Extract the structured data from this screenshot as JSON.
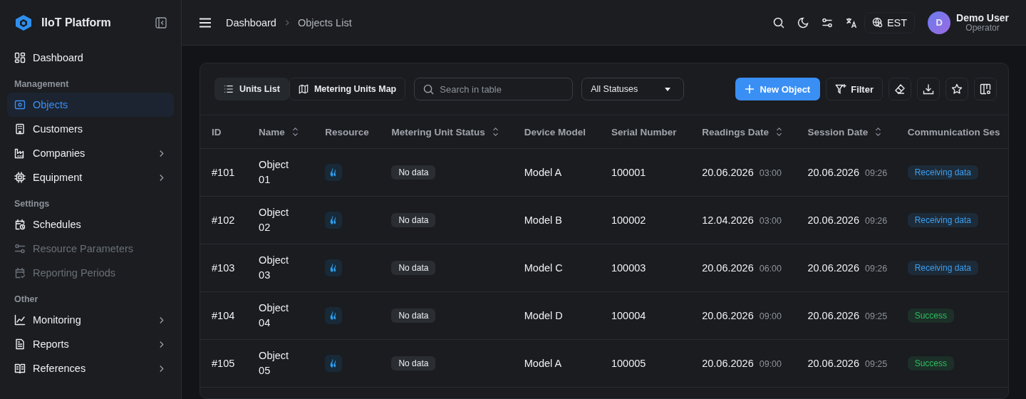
{
  "app": {
    "title": "IIoT Platform"
  },
  "sidebar": {
    "sections": [
      {
        "items": [
          {
            "label": "Dashboard",
            "selected": false,
            "disabled": false,
            "has_submenu": false
          }
        ]
      },
      {
        "heading": "Management",
        "items": [
          {
            "label": "Objects",
            "selected": true,
            "disabled": false,
            "has_submenu": false
          },
          {
            "label": "Customers",
            "selected": false,
            "disabled": false,
            "has_submenu": false
          },
          {
            "label": "Companies",
            "selected": false,
            "disabled": false,
            "has_submenu": true
          },
          {
            "label": "Equipment",
            "selected": false,
            "disabled": false,
            "has_submenu": true
          }
        ]
      },
      {
        "heading": "Settings",
        "items": [
          {
            "label": "Schedules",
            "selected": false,
            "disabled": false,
            "has_submenu": false
          },
          {
            "label": "Resource Parameters",
            "selected": false,
            "disabled": true,
            "has_submenu": false
          },
          {
            "label": "Reporting Periods",
            "selected": false,
            "disabled": true,
            "has_submenu": false
          }
        ]
      },
      {
        "heading": "Other",
        "items": [
          {
            "label": "Monitoring",
            "selected": false,
            "disabled": false,
            "has_submenu": true
          },
          {
            "label": "Reports",
            "selected": false,
            "disabled": false,
            "has_submenu": true
          },
          {
            "label": "References",
            "selected": false,
            "disabled": false,
            "has_submenu": true
          }
        ]
      }
    ]
  },
  "header": {
    "breadcrumbs": [
      "Dashboard",
      "Objects List"
    ],
    "timezone": "EST",
    "user": {
      "initial": "D",
      "name": "Demo User",
      "role": "Operator"
    }
  },
  "toolbar": {
    "views": [
      {
        "label": "Units List",
        "selected": true
      },
      {
        "label": "Metering Units Map",
        "selected": false
      }
    ],
    "search": {
      "placeholder": "Search in table"
    },
    "status_filter": "All Statuses",
    "new_button": "New Object",
    "filter_button": "Filter"
  },
  "table": {
    "columns": [
      {
        "label": "ID",
        "sortable": false
      },
      {
        "label": "Name",
        "sortable": true
      },
      {
        "label": "Resource",
        "sortable": false
      },
      {
        "label": "Metering Unit Status",
        "sortable": true
      },
      {
        "label": "Device Model",
        "sortable": false
      },
      {
        "label": "Serial Number",
        "sortable": false
      },
      {
        "label": "Readings Date",
        "sortable": true
      },
      {
        "label": "Session Date",
        "sortable": true
      },
      {
        "label": "Communication Ses",
        "sortable": false
      }
    ],
    "rows": [
      {
        "id": "#101",
        "name": "Object 01",
        "status": "No data",
        "model": "Model A",
        "serial": "100001",
        "readings_date": "20.06.2026",
        "readings_time": "03:00",
        "session_date": "20.06.2026",
        "session_time": "09:26",
        "session_status": {
          "text": "Receiving data",
          "color": "#3d9ff0"
        }
      },
      {
        "id": "#102",
        "name": "Object 02",
        "status": "No data",
        "model": "Model B",
        "serial": "100002",
        "readings_date": "12.04.2026",
        "readings_time": "03:00",
        "session_date": "20.06.2026",
        "session_time": "09:26",
        "session_status": {
          "text": "Receiving data",
          "color": "#3d9ff0"
        }
      },
      {
        "id": "#103",
        "name": "Object 03",
        "status": "No data",
        "model": "Model C",
        "serial": "100003",
        "readings_date": "20.06.2026",
        "readings_time": "06:00",
        "session_date": "20.06.2026",
        "session_time": "09:26",
        "session_status": {
          "text": "Receiving data",
          "color": "#3d9ff0"
        }
      },
      {
        "id": "#104",
        "name": "Object 04",
        "status": "No data",
        "model": "Model D",
        "serial": "100004",
        "readings_date": "20.06.2026",
        "readings_time": "09:00",
        "session_date": "20.06.2026",
        "session_time": "09:25",
        "session_status": {
          "text": "Success",
          "color": "#2fbf5f"
        }
      },
      {
        "id": "#105",
        "name": "Object 05",
        "status": "No data",
        "model": "Model A",
        "serial": "100005",
        "readings_date": "20.06.2026",
        "readings_time": "09:00",
        "session_date": "20.06.2026",
        "session_time": "09:25",
        "session_status": {
          "text": "Success",
          "color": "#2fbf5f"
        }
      }
    ]
  }
}
